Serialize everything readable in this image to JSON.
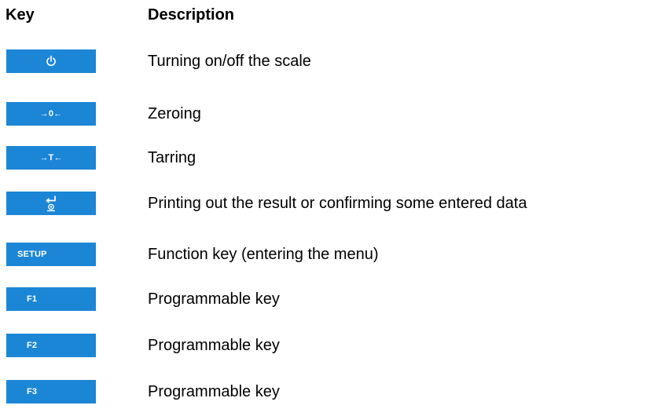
{
  "header": {
    "key_label": "Key",
    "description_label": "Description"
  },
  "colors": {
    "key_background": "#1c86d6",
    "key_foreground": "#ffffff"
  },
  "rows": [
    {
      "key_icon": "power-icon",
      "key_text": "",
      "description": "Turning on/off the scale"
    },
    {
      "key_icon": "zero-icon",
      "key_text": "→0←",
      "description": "Zeroing"
    },
    {
      "key_icon": "tare-icon",
      "key_text": "→T←",
      "description": "Tarring"
    },
    {
      "key_icon": "enter-print-icon",
      "key_text": "",
      "description": "Printing out the result or confirming some entered data"
    },
    {
      "key_icon": "",
      "key_text": "SETUP",
      "description": "Function key (entering the menu)"
    },
    {
      "key_icon": "",
      "key_text": "F1",
      "description": "Programmable key"
    },
    {
      "key_icon": "",
      "key_text": "F2",
      "description": "Programmable key"
    },
    {
      "key_icon": "",
      "key_text": "F3",
      "description": "Programmable key"
    }
  ]
}
